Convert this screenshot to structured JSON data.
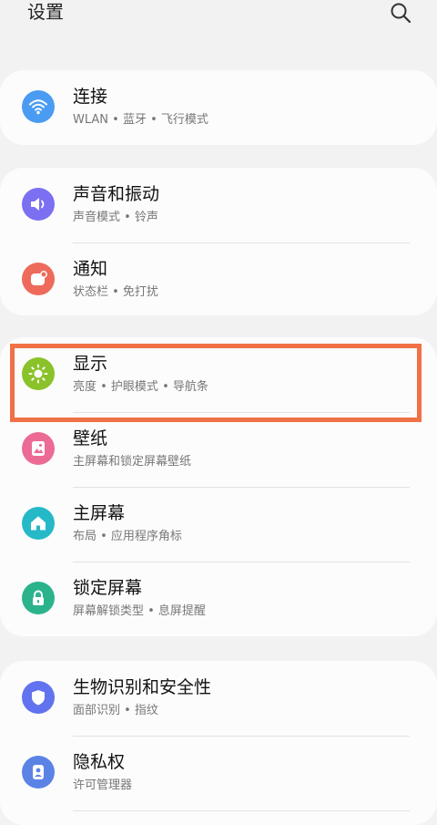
{
  "header": {
    "title": "设置",
    "search_icon": "search-icon"
  },
  "colors": {
    "connections": "#4a9cf3",
    "sounds": "#7b6ff2",
    "notifications": "#ee6a5b",
    "display": "#8ac22a",
    "wallpaper": "#ec6b95",
    "home_screen": "#25b9c8",
    "lock_screen": "#2bb38c",
    "biometrics": "#6173ee",
    "privacy": "#5b83e6",
    "highlight_border": "#f07145"
  },
  "cards": [
    {
      "items": [
        {
          "title": "连接",
          "subtitle": "WLAN • 蓝牙 • 飞行模式",
          "icon": "wifi-icon"
        }
      ]
    },
    {
      "items": [
        {
          "title": "声音和振动",
          "subtitle": "声音模式 • 铃声",
          "icon": "speaker-icon"
        },
        {
          "title": "通知",
          "subtitle": "状态栏 • 免打扰",
          "icon": "notification-icon"
        }
      ]
    },
    {
      "items": [
        {
          "title": "显示",
          "subtitle": "亮度 • 护眼模式 • 导航条",
          "icon": "brightness-icon"
        },
        {
          "title": "壁纸",
          "subtitle": "主屏幕和锁定屏幕壁纸",
          "icon": "wallpaper-icon"
        },
        {
          "title": "主屏幕",
          "subtitle": "布局 • 应用程序角标",
          "icon": "home-icon"
        },
        {
          "title": "锁定屏幕",
          "subtitle": "屏幕解锁类型 • 息屏提醒",
          "icon": "lock-icon"
        }
      ]
    },
    {
      "items": [
        {
          "title": "生物识别和安全性",
          "subtitle": "面部识别 • 指纹",
          "icon": "shield-icon"
        },
        {
          "title": "隐私权",
          "subtitle": "许可管理器",
          "icon": "privacy-icon"
        }
      ]
    }
  ]
}
